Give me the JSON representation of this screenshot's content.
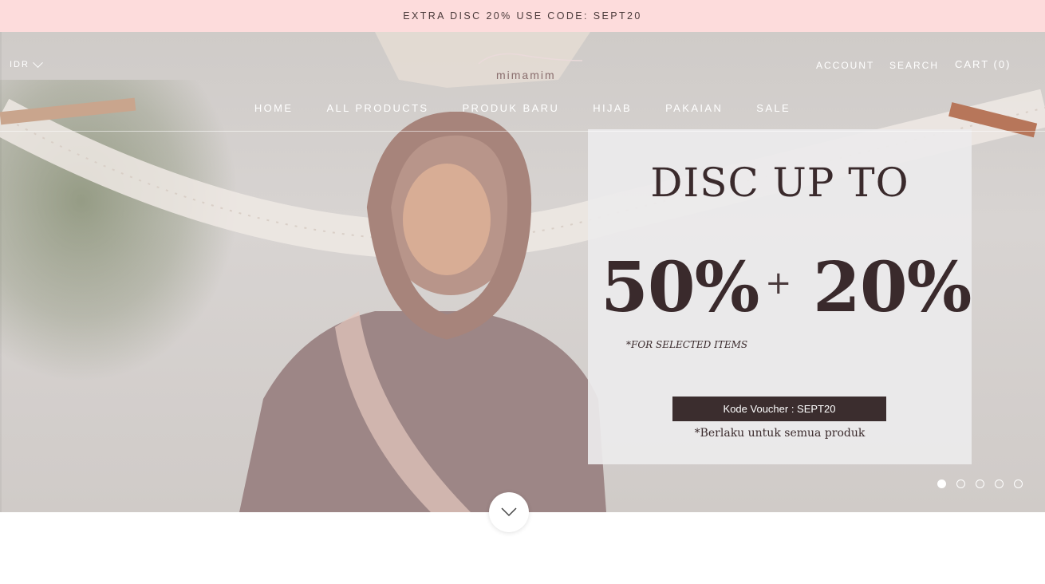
{
  "announcement": "EXTRA DISC 20% USE CODE: SEPT20",
  "header": {
    "currency": "IDR",
    "logo_text": "mimamim",
    "account": "ACCOUNT",
    "search": "SEARCH",
    "cart": "CART (0)"
  },
  "nav": [
    "HOME",
    "ALL PRODUCTS",
    "PRODUK BARU",
    "HIJAB",
    "PAKAIAN",
    "SALE"
  ],
  "promo": {
    "headline": "DISC UP TO",
    "percent_a": "50%",
    "plus": "+",
    "percent_b": "20%",
    "note": "*FOR SELECTED ITEMS",
    "voucher": "Kode Voucher : SEPT20",
    "footer": "*Berlaku untuk semua produk"
  },
  "slideshow": {
    "count": 5,
    "active": 1
  },
  "colors": {
    "announcement_bg": "#fddcdc",
    "voucher_bg": "#3b2d2e",
    "text_dark": "#3a2a2c"
  },
  "icons": {
    "currency_toggle": "chevron-down-icon",
    "scroll_down": "chevron-down-icon"
  }
}
